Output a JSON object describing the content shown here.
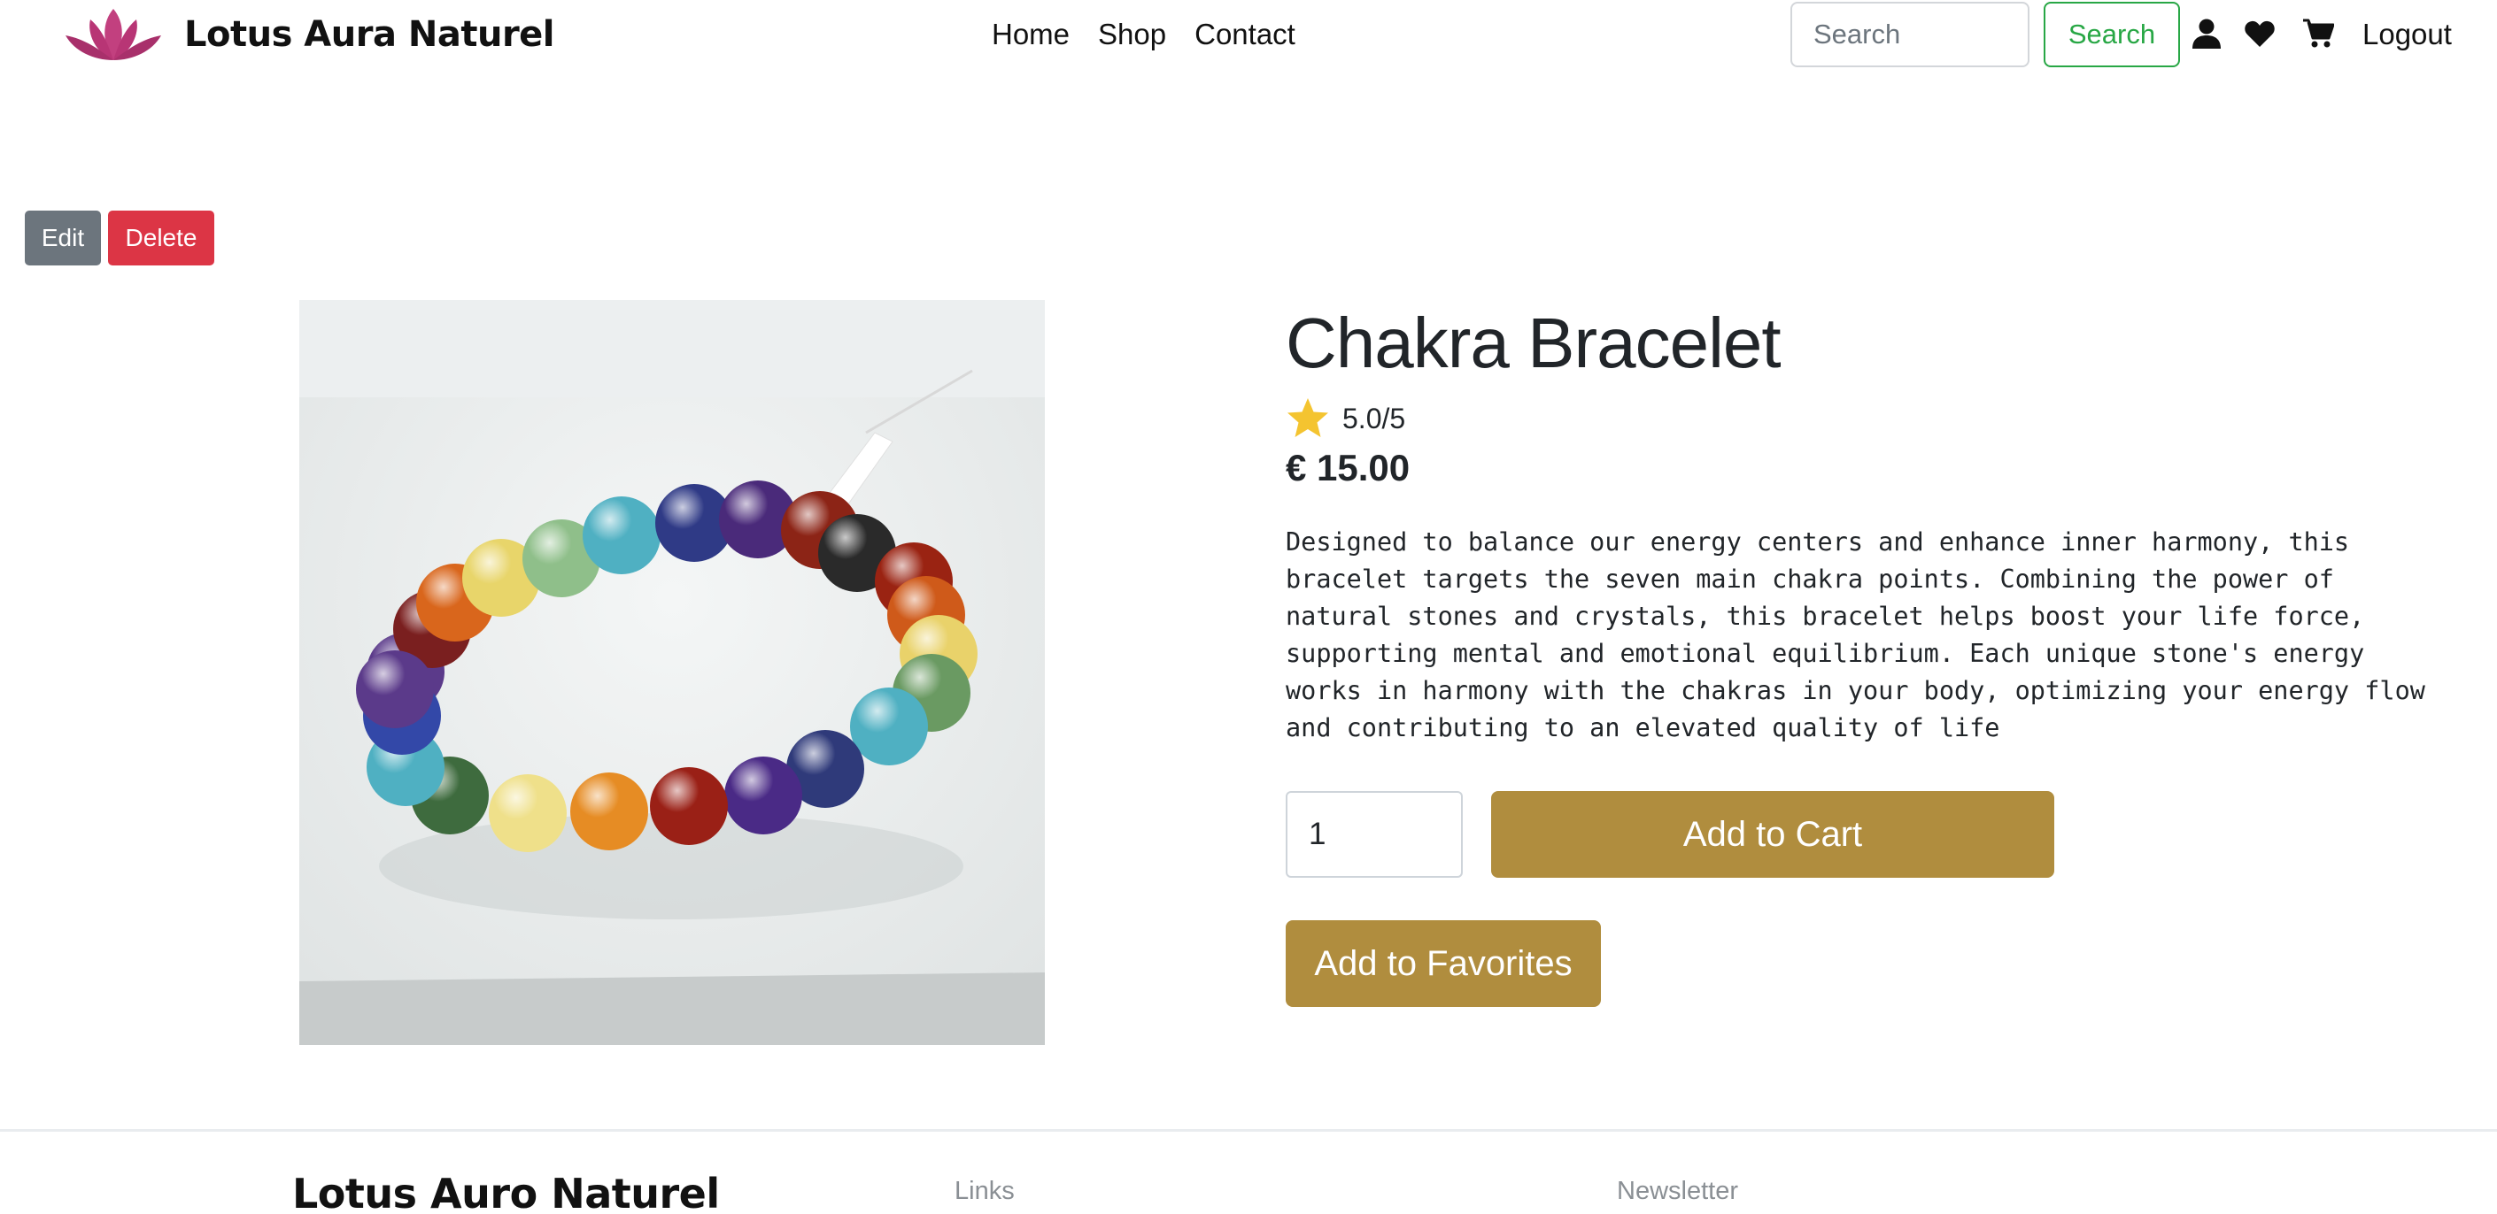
{
  "navbar": {
    "brand": "Lotus Aura Naturel",
    "links": [
      "Home",
      "Shop",
      "Contact"
    ],
    "search_placeholder": "Search",
    "search_button": "Search",
    "logout": "Logout",
    "icons": [
      "user-icon",
      "heart-icon",
      "cart-icon"
    ]
  },
  "admin": {
    "edit_label": "Edit",
    "delete_label": "Delete"
  },
  "product": {
    "title": "Chakra Bracelet",
    "rating": "5.0/5",
    "price": "€ 15.00",
    "description": "Designed to balance our energy centers and enhance inner harmony, this bracelet targets the seven main chakra points. Combining the power of natural stones and crystals, this bracelet helps boost your life force, supporting mental and emotional equilibrium. Each unique stone's energy works in harmony with the chakras in your body, optimizing your energy flow and contributing to an elevated quality of life",
    "quantity": "1",
    "add_to_cart": "Add to Cart",
    "add_to_favorites": "Add to Favorites"
  },
  "footer": {
    "brand": "Lotus Auro Naturel",
    "links_heading": "Links",
    "newsletter_heading": "Newsletter"
  },
  "colors": {
    "accent_gold": "#b08d3e",
    "search_green": "#28a745",
    "delete_red": "#dc3545",
    "edit_gray": "#6c757d",
    "lotus_pink": "#c2407f",
    "star_yellow": "#f4c430"
  }
}
